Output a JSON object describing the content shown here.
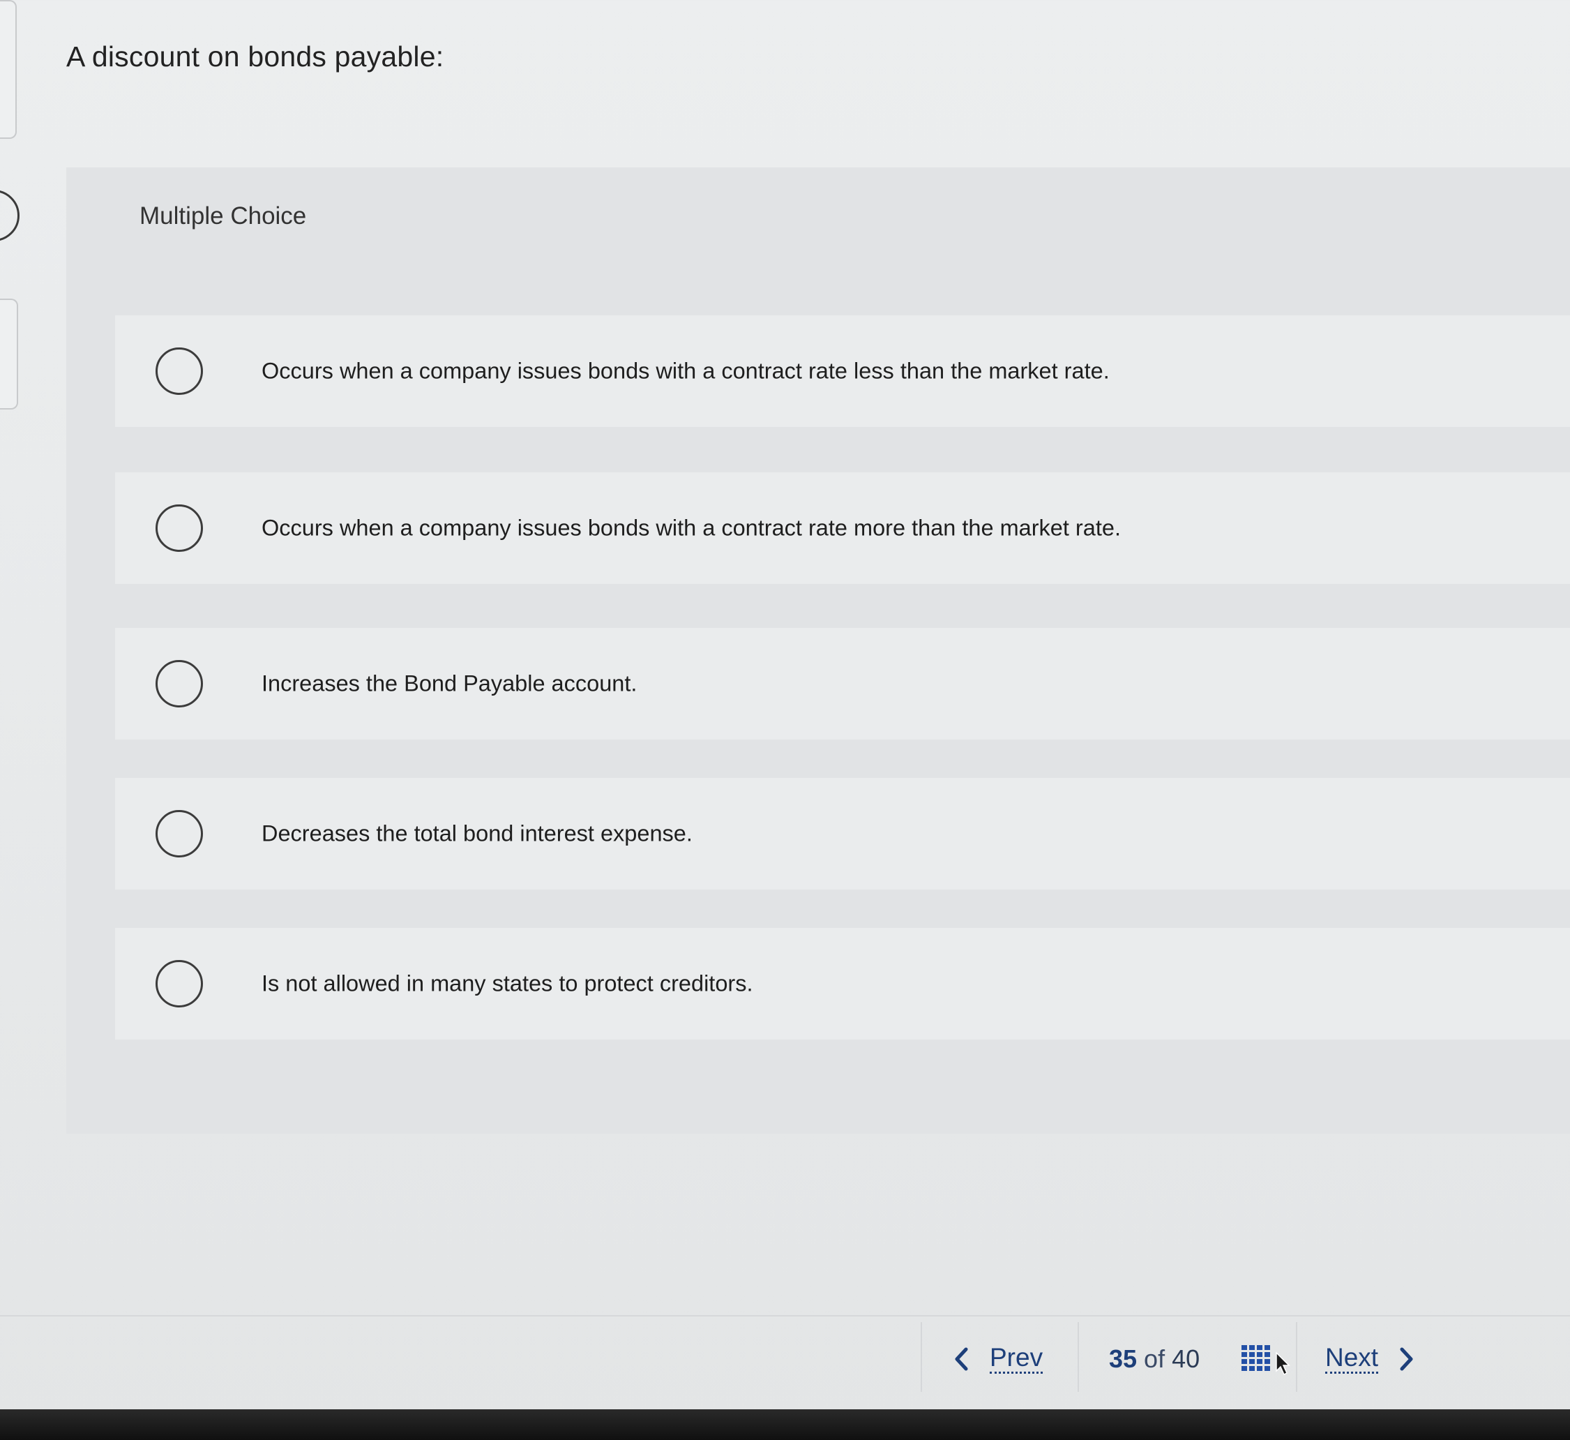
{
  "question": {
    "title": "A discount on bonds payable:"
  },
  "multiple_choice": {
    "label": "Multiple Choice",
    "options": [
      {
        "text": "Occurs when a company issues bonds with a contract rate less than the market rate.",
        "selected": false
      },
      {
        "text": "Occurs when a company issues bonds with a contract rate more than the market rate.",
        "selected": false
      },
      {
        "text": "Increases the Bond Payable account.",
        "selected": false
      },
      {
        "text": "Decreases the total bond interest expense.",
        "selected": false
      },
      {
        "text": "Is not allowed in many states to protect creditors.",
        "selected": false
      }
    ]
  },
  "pager": {
    "prev_label": "Prev",
    "current": "35",
    "of_label": "of",
    "total": "40",
    "next_label": "Next",
    "grid_icon": "grid-icon"
  },
  "colors": {
    "link": "#1d3f7a",
    "grid_icon": "#2350a6",
    "background": "#eceeef",
    "panel": "#e1e3e5",
    "option_bg": "#eaeced"
  }
}
